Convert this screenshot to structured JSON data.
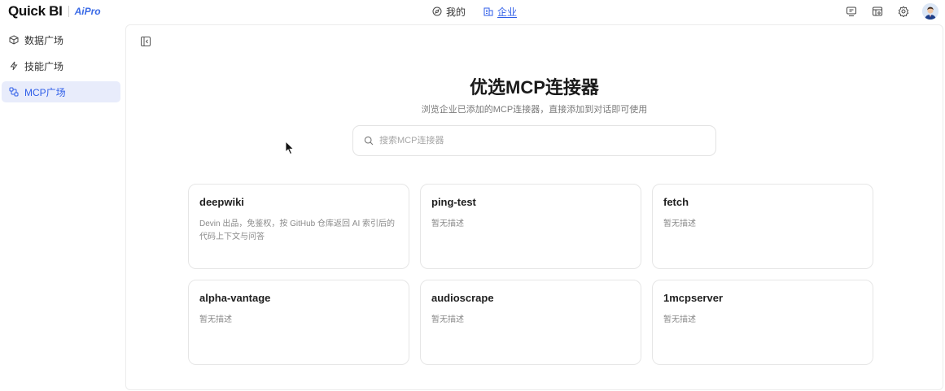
{
  "brand": {
    "name": "Quick BI",
    "badge": "AiPro"
  },
  "topnav": [
    {
      "label": "我的",
      "icon": "compass-icon",
      "active": false
    },
    {
      "label": "企业",
      "icon": "building-icon",
      "active": true
    }
  ],
  "top_actions": [
    "monitor-icon",
    "layout-icon",
    "settings-icon",
    "avatar"
  ],
  "sidebar": {
    "items": [
      {
        "label": "数据广场",
        "icon": "cube-icon",
        "active": false
      },
      {
        "label": "技能广场",
        "icon": "lightning-icon",
        "active": false
      },
      {
        "label": "MCP广场",
        "icon": "connector-icon",
        "active": true
      }
    ]
  },
  "main": {
    "title": "优选MCP连接器",
    "subtitle": "浏览企业已添加的MCP连接器，直接添加到对话即可使用",
    "search": {
      "placeholder": "搜索MCP连接器",
      "value": ""
    },
    "cards": [
      {
        "title": "deepwiki",
        "desc": "Devin 出品，免鉴权，按 GitHub 仓库返回 AI 索引后的代码上下文与问答"
      },
      {
        "title": "ping-test",
        "desc": "暂无描述"
      },
      {
        "title": "fetch",
        "desc": "暂无描述"
      },
      {
        "title": "alpha-vantage",
        "desc": "暂无描述"
      },
      {
        "title": "audioscrape",
        "desc": "暂无描述"
      },
      {
        "title": "1mcpserver",
        "desc": "暂无描述"
      }
    ]
  },
  "colors": {
    "accent": "#2f5ee8",
    "active_bg": "#e8ecfb",
    "border": "#e6e6e6"
  }
}
